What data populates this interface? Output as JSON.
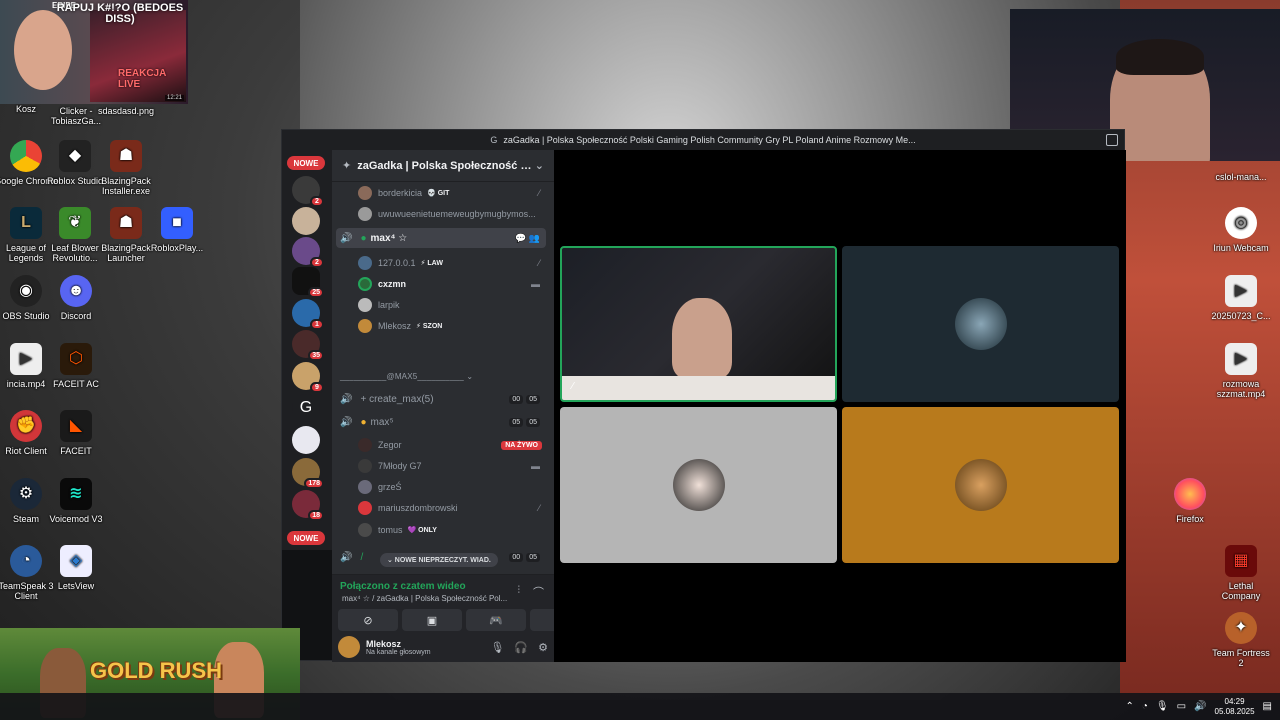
{
  "desktop": {
    "left_icons": [
      {
        "label": "Kosz",
        "x": "top"
      },
      {
        "label": "Clicker - TobiaszGa..."
      },
      {
        "label": "sdasdasd.png"
      },
      {
        "label": "Google Chrome"
      },
      {
        "label": "Roblox Studio"
      },
      {
        "label": "BlazingPack Installer.exe"
      },
      {
        "label": "League of Legends"
      },
      {
        "label": "Leaf Blower Revolutio..."
      },
      {
        "label": "BlazingPack Launcher"
      },
      {
        "label": "RobloxPlay..."
      },
      {
        "label": "OBS Studio"
      },
      {
        "label": "Discord"
      },
      {
        "label": "incia.mp4"
      },
      {
        "label": "FACEIT AC"
      },
      {
        "label": "Riot Client"
      },
      {
        "label": "FACEIT"
      },
      {
        "label": "Steam"
      },
      {
        "label": "Voicemod V3"
      },
      {
        "label": "TeamSpeak 3 Client"
      },
      {
        "label": "LetsView"
      }
    ],
    "right_icons": [
      {
        "label": "cslol-mana..."
      },
      {
        "label": "Iriun Webcam"
      },
      {
        "label": "20250723_C..."
      },
      {
        "label": "rozmowa szzmat.mp4"
      },
      {
        "label": "Firefox"
      },
      {
        "label": "Lethal Company"
      },
      {
        "label": "Team Fortress 2"
      }
    ]
  },
  "stream_overlay": {
    "brand": "ERIPE",
    "title": "RAPUJ K#!?O (BEDOES DISS)",
    "tag": "REAKCJA LIVE",
    "time": "12:21"
  },
  "discord": {
    "window_title": "zaGadka | Polska Społeczność Polski Gaming Polish Community Gry PL Poland Anime Rozmowy Me...",
    "rail_new_top": "NOWE",
    "rail_new_bottom": "NOWE",
    "rail_counts": [
      "2",
      "",
      "2",
      "25",
      "1",
      "35",
      "9",
      "",
      "",
      "178",
      "18"
    ],
    "server_name": "zaGadka | Polska Społeczność Pols...",
    "channel_rows": {
      "u_borderkicia": "borderkicia",
      "u_borderkicia_role": "💀 GIT",
      "u_uwu": "uwuwueenietuemeweugbymugbymos...",
      "vc_max4": "max⁴ ☆",
      "u_127": "127.0.0.1",
      "u_127_role": "⚡ LAW",
      "u_cxzmn": "cxzmn",
      "u_larpik": "larpik",
      "u_mlekosz": "Mlekosz",
      "u_mlekosz_role": "⚡ SZON",
      "category": "__________@MAX5__________ ⌄",
      "vc_create": "+ create_max(5)",
      "vc_create_counts": [
        "00",
        "05"
      ],
      "vc_max5": "max⁵",
      "vc_max5_counts": [
        "05",
        "05"
      ],
      "u_zegor": "Zegor",
      "u_zegor_live": "NA ŻYWO",
      "u_7mlody": "7Młody G7",
      "u_grzes": "grzeŚ",
      "u_mariusz": "mariuszdombrowski",
      "u_tomus": "tomus",
      "u_tomus_role": "💜 ONLY",
      "vc_last_counts": [
        "00",
        "05"
      ]
    },
    "unread_pill": "⌄ NOWE NIEPRZECZYT. WIAD.",
    "voice_panel": {
      "status": "Połączono z czatem wideo",
      "sub": "max⁴ ☆ / zaGadka | Polska Społeczność Pol..."
    },
    "user_panel": {
      "name": "Mlekosz",
      "status": "Na kanale głosowym"
    },
    "tiles": [
      {
        "kind": "camera",
        "color": "#1a1a1a",
        "border": "#23a55a"
      },
      {
        "kind": "avatar",
        "color": "#1e2a32"
      },
      {
        "kind": "avatar",
        "color": "#b5b5b5"
      },
      {
        "kind": "avatar",
        "color": "#b87a1c"
      }
    ]
  },
  "game_banner": {
    "title": "GOLD RUSH"
  },
  "taskbar": {
    "time": "04:29",
    "date": "05.08.2025"
  }
}
